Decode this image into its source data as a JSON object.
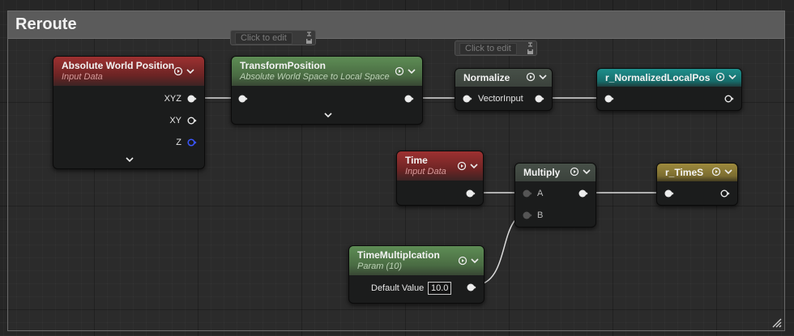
{
  "comment": {
    "title": "Reroute"
  },
  "bubbles": {
    "transform_hint": "Click to edit",
    "normalize_hint": "Click to edit"
  },
  "nodes": {
    "absolute_world_position": {
      "title": "Absolute World Position",
      "subtitle": "Input Data",
      "outputs": [
        "XYZ",
        "XY",
        "Z"
      ]
    },
    "transform_position": {
      "title": "TransformPosition",
      "subtitle": "Absolute World Space to Local Space"
    },
    "normalize": {
      "title": "Normalize",
      "input_label": "VectorInput"
    },
    "r_normalized_local_pos": {
      "title": "r_NormalizedLocalPos"
    },
    "time": {
      "title": "Time",
      "subtitle": "Input Data"
    },
    "multiply": {
      "title": "Multiply",
      "inputs": [
        "A",
        "B"
      ]
    },
    "r_time_s": {
      "title": "r_TimeS"
    },
    "time_multiplication": {
      "title": "TimeMultiplcation",
      "subtitle": "Param (10)",
      "default_label": "Default Value",
      "default_value": "10.0"
    }
  },
  "colors": {
    "input_node_header": "#9e3131",
    "function_node_header": "#5e8d55",
    "named_reroute_teal": "#1e8f8c",
    "named_reroute_gold": "#9d8a3d",
    "z_pin": "#3b57ff"
  },
  "icons": [
    "preview-toggle-icon",
    "collapse-chevron-icon",
    "pin-icon",
    "floppy-icon",
    "resize-grip-icon"
  ]
}
